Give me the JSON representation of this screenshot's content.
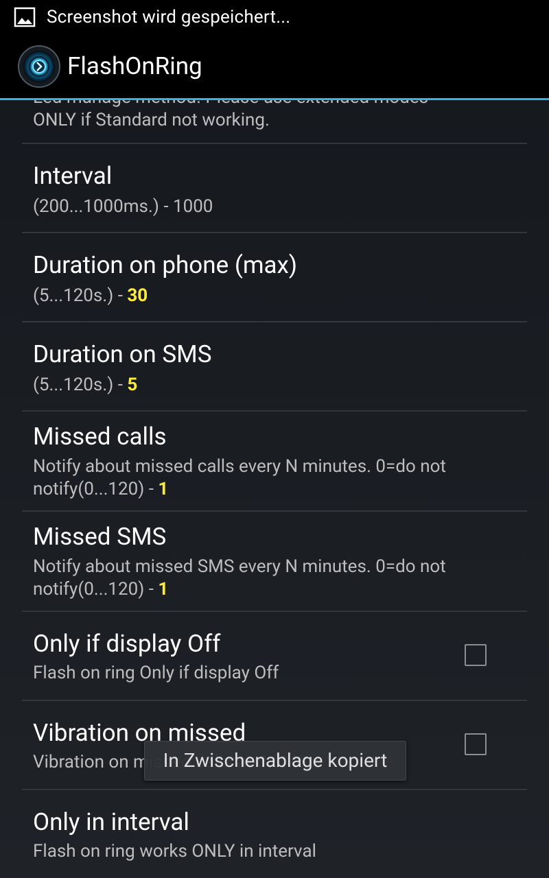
{
  "status_bar": {
    "icon": "image-icon",
    "text": "Screenshot wird gespeichert..."
  },
  "action_bar": {
    "icon": "flashonring-app-icon",
    "title": "FlashOnRing"
  },
  "prefs": {
    "led_method": {
      "summary_line1": "Led manage method. Please use extended modes",
      "summary_line2": "ONLY if Standard not working."
    },
    "interval": {
      "title": "Interval",
      "summary": "(200...1000ms.) - 1000"
    },
    "duration_phone": {
      "title": "Duration on phone (max)",
      "summary_prefix": "(5...120s.) - ",
      "value": "30"
    },
    "duration_sms": {
      "title": "Duration on SMS",
      "summary_prefix": "(5...120s.) - ",
      "value": "5"
    },
    "missed_calls": {
      "title": "Missed calls",
      "summary_line1": "Notify about missed calls every N minutes. 0=do not",
      "summary_line2_prefix": "notify(0...120) - ",
      "value": "1"
    },
    "missed_sms": {
      "title": "Missed SMS",
      "summary_line1": "Notify about missed SMS every N minutes. 0=do not",
      "summary_line2_prefix": "notify(0...120) - ",
      "value": "1"
    },
    "display_off": {
      "title": "Only if display Off",
      "summary": "Flash on ring Only if display Off",
      "checked": false
    },
    "vibration_missed": {
      "title": "Vibration on missed",
      "summary": "Vibration on missed calls and SMS",
      "checked": false
    },
    "only_interval": {
      "title": "Only in interval",
      "summary": "Flash on ring works ONLY in interval"
    }
  },
  "toast": {
    "text": "In Zwischenablage kopiert"
  },
  "colors": {
    "accent": "#33b5e5",
    "value_highlight": "#ffeb3b"
  }
}
